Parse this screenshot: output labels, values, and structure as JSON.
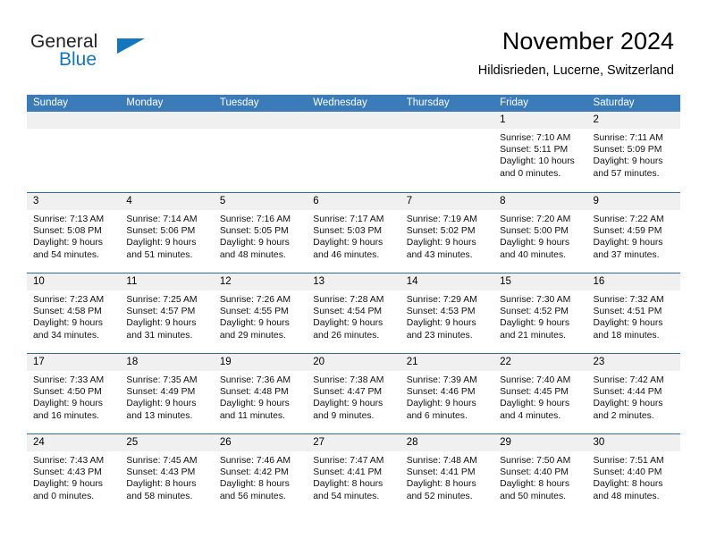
{
  "brand": {
    "name_primary": "General",
    "name_secondary": "Blue",
    "accent_color": "#1277bc"
  },
  "header": {
    "title": "November 2024",
    "subtitle": "Hildisrieden, Lucerne, Switzerland"
  },
  "theme": {
    "header_bg": "#3b7cb8",
    "header_text": "#ffffff",
    "daynum_bg": "#f0f0f0",
    "row_divider": "#2e6da4"
  },
  "weekdays": [
    "Sunday",
    "Monday",
    "Tuesday",
    "Wednesday",
    "Thursday",
    "Friday",
    "Saturday"
  ],
  "weeks": [
    [
      {
        "day": "",
        "sunrise": "",
        "sunset": "",
        "daylight1": "",
        "daylight2": ""
      },
      {
        "day": "",
        "sunrise": "",
        "sunset": "",
        "daylight1": "",
        "daylight2": ""
      },
      {
        "day": "",
        "sunrise": "",
        "sunset": "",
        "daylight1": "",
        "daylight2": ""
      },
      {
        "day": "",
        "sunrise": "",
        "sunset": "",
        "daylight1": "",
        "daylight2": ""
      },
      {
        "day": "",
        "sunrise": "",
        "sunset": "",
        "daylight1": "",
        "daylight2": ""
      },
      {
        "day": "1",
        "sunrise": "Sunrise: 7:10 AM",
        "sunset": "Sunset: 5:11 PM",
        "daylight1": "Daylight: 10 hours",
        "daylight2": "and 0 minutes."
      },
      {
        "day": "2",
        "sunrise": "Sunrise: 7:11 AM",
        "sunset": "Sunset: 5:09 PM",
        "daylight1": "Daylight: 9 hours",
        "daylight2": "and 57 minutes."
      }
    ],
    [
      {
        "day": "3",
        "sunrise": "Sunrise: 7:13 AM",
        "sunset": "Sunset: 5:08 PM",
        "daylight1": "Daylight: 9 hours",
        "daylight2": "and 54 minutes."
      },
      {
        "day": "4",
        "sunrise": "Sunrise: 7:14 AM",
        "sunset": "Sunset: 5:06 PM",
        "daylight1": "Daylight: 9 hours",
        "daylight2": "and 51 minutes."
      },
      {
        "day": "5",
        "sunrise": "Sunrise: 7:16 AM",
        "sunset": "Sunset: 5:05 PM",
        "daylight1": "Daylight: 9 hours",
        "daylight2": "and 48 minutes."
      },
      {
        "day": "6",
        "sunrise": "Sunrise: 7:17 AM",
        "sunset": "Sunset: 5:03 PM",
        "daylight1": "Daylight: 9 hours",
        "daylight2": "and 46 minutes."
      },
      {
        "day": "7",
        "sunrise": "Sunrise: 7:19 AM",
        "sunset": "Sunset: 5:02 PM",
        "daylight1": "Daylight: 9 hours",
        "daylight2": "and 43 minutes."
      },
      {
        "day": "8",
        "sunrise": "Sunrise: 7:20 AM",
        "sunset": "Sunset: 5:00 PM",
        "daylight1": "Daylight: 9 hours",
        "daylight2": "and 40 minutes."
      },
      {
        "day": "9",
        "sunrise": "Sunrise: 7:22 AM",
        "sunset": "Sunset: 4:59 PM",
        "daylight1": "Daylight: 9 hours",
        "daylight2": "and 37 minutes."
      }
    ],
    [
      {
        "day": "10",
        "sunrise": "Sunrise: 7:23 AM",
        "sunset": "Sunset: 4:58 PM",
        "daylight1": "Daylight: 9 hours",
        "daylight2": "and 34 minutes."
      },
      {
        "day": "11",
        "sunrise": "Sunrise: 7:25 AM",
        "sunset": "Sunset: 4:57 PM",
        "daylight1": "Daylight: 9 hours",
        "daylight2": "and 31 minutes."
      },
      {
        "day": "12",
        "sunrise": "Sunrise: 7:26 AM",
        "sunset": "Sunset: 4:55 PM",
        "daylight1": "Daylight: 9 hours",
        "daylight2": "and 29 minutes."
      },
      {
        "day": "13",
        "sunrise": "Sunrise: 7:28 AM",
        "sunset": "Sunset: 4:54 PM",
        "daylight1": "Daylight: 9 hours",
        "daylight2": "and 26 minutes."
      },
      {
        "day": "14",
        "sunrise": "Sunrise: 7:29 AM",
        "sunset": "Sunset: 4:53 PM",
        "daylight1": "Daylight: 9 hours",
        "daylight2": "and 23 minutes."
      },
      {
        "day": "15",
        "sunrise": "Sunrise: 7:30 AM",
        "sunset": "Sunset: 4:52 PM",
        "daylight1": "Daylight: 9 hours",
        "daylight2": "and 21 minutes."
      },
      {
        "day": "16",
        "sunrise": "Sunrise: 7:32 AM",
        "sunset": "Sunset: 4:51 PM",
        "daylight1": "Daylight: 9 hours",
        "daylight2": "and 18 minutes."
      }
    ],
    [
      {
        "day": "17",
        "sunrise": "Sunrise: 7:33 AM",
        "sunset": "Sunset: 4:50 PM",
        "daylight1": "Daylight: 9 hours",
        "daylight2": "and 16 minutes."
      },
      {
        "day": "18",
        "sunrise": "Sunrise: 7:35 AM",
        "sunset": "Sunset: 4:49 PM",
        "daylight1": "Daylight: 9 hours",
        "daylight2": "and 13 minutes."
      },
      {
        "day": "19",
        "sunrise": "Sunrise: 7:36 AM",
        "sunset": "Sunset: 4:48 PM",
        "daylight1": "Daylight: 9 hours",
        "daylight2": "and 11 minutes."
      },
      {
        "day": "20",
        "sunrise": "Sunrise: 7:38 AM",
        "sunset": "Sunset: 4:47 PM",
        "daylight1": "Daylight: 9 hours",
        "daylight2": "and 9 minutes."
      },
      {
        "day": "21",
        "sunrise": "Sunrise: 7:39 AM",
        "sunset": "Sunset: 4:46 PM",
        "daylight1": "Daylight: 9 hours",
        "daylight2": "and 6 minutes."
      },
      {
        "day": "22",
        "sunrise": "Sunrise: 7:40 AM",
        "sunset": "Sunset: 4:45 PM",
        "daylight1": "Daylight: 9 hours",
        "daylight2": "and 4 minutes."
      },
      {
        "day": "23",
        "sunrise": "Sunrise: 7:42 AM",
        "sunset": "Sunset: 4:44 PM",
        "daylight1": "Daylight: 9 hours",
        "daylight2": "and 2 minutes."
      }
    ],
    [
      {
        "day": "24",
        "sunrise": "Sunrise: 7:43 AM",
        "sunset": "Sunset: 4:43 PM",
        "daylight1": "Daylight: 9 hours",
        "daylight2": "and 0 minutes."
      },
      {
        "day": "25",
        "sunrise": "Sunrise: 7:45 AM",
        "sunset": "Sunset: 4:43 PM",
        "daylight1": "Daylight: 8 hours",
        "daylight2": "and 58 minutes."
      },
      {
        "day": "26",
        "sunrise": "Sunrise: 7:46 AM",
        "sunset": "Sunset: 4:42 PM",
        "daylight1": "Daylight: 8 hours",
        "daylight2": "and 56 minutes."
      },
      {
        "day": "27",
        "sunrise": "Sunrise: 7:47 AM",
        "sunset": "Sunset: 4:41 PM",
        "daylight1": "Daylight: 8 hours",
        "daylight2": "and 54 minutes."
      },
      {
        "day": "28",
        "sunrise": "Sunrise: 7:48 AM",
        "sunset": "Sunset: 4:41 PM",
        "daylight1": "Daylight: 8 hours",
        "daylight2": "and 52 minutes."
      },
      {
        "day": "29",
        "sunrise": "Sunrise: 7:50 AM",
        "sunset": "Sunset: 4:40 PM",
        "daylight1": "Daylight: 8 hours",
        "daylight2": "and 50 minutes."
      },
      {
        "day": "30",
        "sunrise": "Sunrise: 7:51 AM",
        "sunset": "Sunset: 4:40 PM",
        "daylight1": "Daylight: 8 hours",
        "daylight2": "and 48 minutes."
      }
    ]
  ]
}
